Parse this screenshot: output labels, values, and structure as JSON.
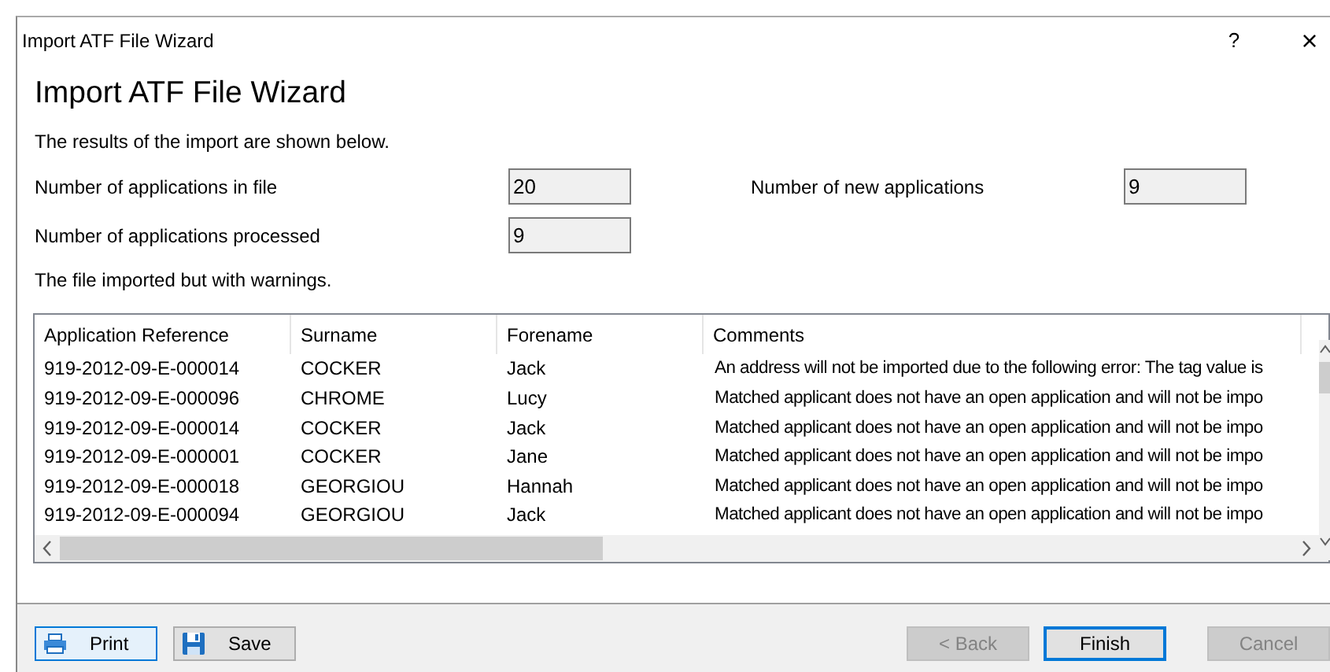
{
  "window": {
    "title": "Import ATF File Wizard",
    "help": "?",
    "close": "×"
  },
  "heading": "Import ATF File Wizard",
  "description": "The results of the import are shown below.",
  "stats": [
    {
      "label": "Number of applications in file",
      "value": "20"
    },
    {
      "label": "Number of new applications",
      "value": "9"
    },
    {
      "label": "Number of applications processed",
      "value": "9"
    }
  ],
  "status_text": "The file imported but with warnings.",
  "table": {
    "columns": [
      "Application Reference",
      "Surname",
      "Forename",
      "Comments"
    ],
    "rows": [
      [
        "919-2012-09-E-000014",
        "COCKER",
        "Jack",
        "An address will not be imported due to the following error: The tag value is"
      ],
      [
        "919-2012-09-E-000096",
        "CHROME",
        "Lucy",
        "Matched applicant does not have an open application and will not be impo"
      ],
      [
        "919-2012-09-E-000014",
        "COCKER",
        "Jack",
        "Matched applicant does not have an open application and will not be impo"
      ],
      [
        "919-2012-09-E-000001",
        "COCKER",
        "Jane",
        "Matched applicant does not have an open application and will not be impo"
      ],
      [
        "919-2012-09-E-000018",
        "GEORGIOU",
        "Hannah",
        "Matched applicant does not have an open application and will not be impo"
      ],
      [
        "919-2012-09-E-000094",
        "GEORGIOU",
        "Jack",
        "Matched applicant does not have an open application and will not be impo"
      ]
    ]
  },
  "left_buttons": [
    {
      "label": "Print",
      "focused": true,
      "disabled": false
    },
    {
      "label": "Save",
      "focused": false,
      "disabled": false
    }
  ],
  "right_buttons": [
    {
      "label": "< Back",
      "default": false,
      "disabled": true
    },
    {
      "label": "Finish",
      "default": true,
      "disabled": false
    },
    {
      "label": "Cancel",
      "default": false,
      "disabled": true
    }
  ]
}
